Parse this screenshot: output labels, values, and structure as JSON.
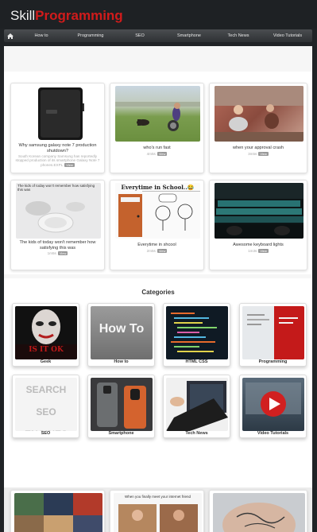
{
  "site": {
    "logo_part1": "Skill",
    "logo_part2": "Programming"
  },
  "nav": {
    "home_icon": "home-icon",
    "items": [
      "How to",
      "Programming",
      "SEO",
      "Smartphone",
      "Tech News",
      "Video Tutorials"
    ]
  },
  "featured": [
    {
      "title": "Why samsung galaxy note 7 production shutdown?",
      "summary": "South Korean company Samsung has reportedly stopped production of its smartphone Galaxy Note 7 phones.EXPL",
      "badge": "View"
    },
    {
      "title": "who's run fast",
      "meta": "4m5s",
      "badge": "View"
    },
    {
      "title": "when your approval crash",
      "meta": "3m5s",
      "badge": "View"
    },
    {
      "overlay": "The kids of today won't remember how satisfying this was",
      "title": "The kids of today won't remember how satisfying this was",
      "meta": "1m5s",
      "badge": "View"
    },
    {
      "overlay": "Everytime in School..😂",
      "title": "Everytime in shcool",
      "meta": "2m5s",
      "badge": "View"
    },
    {
      "title": "Awesome keyboard lights",
      "meta": "1m3s",
      "badge": "View"
    }
  ],
  "categories": {
    "heading": "Categories",
    "items": [
      {
        "label": "Geek",
        "art": "IS IT OK"
      },
      {
        "label": "How to",
        "art": "How To"
      },
      {
        "label": "HTML CSS"
      },
      {
        "label": "Programming"
      },
      {
        "label": "SEO",
        "art": "SEARCH SEO ENGINES"
      },
      {
        "label": "Smartphone"
      },
      {
        "label": "Tech News"
      },
      {
        "label": "Video Tutorials"
      }
    ]
  },
  "bottom": {
    "card2_text": "When you finally meet your internet friend"
  },
  "colors": {
    "brand_red": "#d11b1b",
    "header_bg": "#1e2124"
  }
}
